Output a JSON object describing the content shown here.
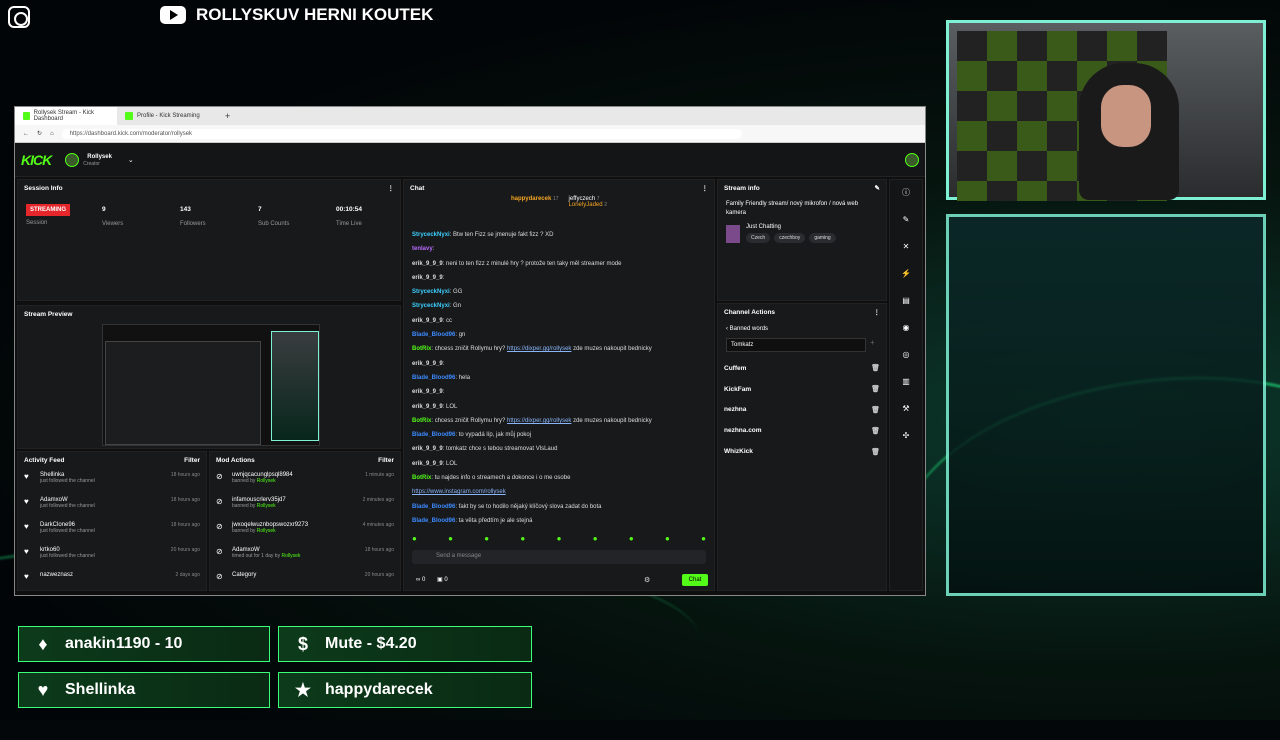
{
  "overlay": {
    "youtube_title": "ROLLYSKUV HERNI KOUTEK",
    "alerts": [
      {
        "icon": "diamond-icon",
        "glyph": "♦",
        "text": "anakin1190 - 10"
      },
      {
        "icon": "dollar-icon",
        "glyph": "$",
        "text": "Mute - $4.20"
      },
      {
        "icon": "heart-icon",
        "glyph": "♥",
        "text": "Shellinka"
      },
      {
        "icon": "star-icon",
        "glyph": "★",
        "text": "happydarecek"
      }
    ]
  },
  "browser": {
    "tabs": [
      "Rollysek Stream - Kick Dashboard",
      "Profile - Kick Streaming"
    ],
    "url": "https://dashboard.kick.com/moderator/rollysek"
  },
  "header": {
    "logo": "KICK",
    "user": "Rollysek",
    "role": "Creator"
  },
  "session": {
    "title": "Session Info",
    "status": "STREAMING",
    "status_label": "Session",
    "viewers": "9",
    "viewers_label": "Viewers",
    "followers": "143",
    "followers_label": "Followers",
    "subs": "7",
    "subs_label": "Sub Counts",
    "time": "00:10:54",
    "time_label": "Time Live"
  },
  "preview": {
    "title": "Stream Preview"
  },
  "activity": {
    "title": "Activity Feed",
    "filter": "Filter",
    "items": [
      {
        "name": "Shellinka",
        "sub": "just followed the channel",
        "time": "18 hours ago"
      },
      {
        "name": "AdamxoW",
        "sub": "just followed the channel",
        "time": "18 hours ago"
      },
      {
        "name": "DarkClone96",
        "sub": "just followed the channel",
        "time": "18 hours ago"
      },
      {
        "name": "krtko60",
        "sub": "just followed the channel",
        "time": "20 hours ago"
      },
      {
        "name": "nazweznasz",
        "sub": "",
        "time": "2 days ago"
      }
    ]
  },
  "mod": {
    "title": "Mod Actions",
    "filter": "Filter",
    "items": [
      {
        "name": "uwnjqcacunglpsql8984",
        "sub": "banned by",
        "by": "Rollysek",
        "time": "1 minute ago"
      },
      {
        "name": "infamouscrlerv35jd7",
        "sub": "banned by",
        "by": "Rollysek",
        "time": "2 minutes ago"
      },
      {
        "name": "jwxoqelwuznbopswozxr9273",
        "sub": "banned by",
        "by": "Rollysek",
        "time": "4 minutes ago"
      },
      {
        "name": "AdamxoW",
        "sub": "timed out for 1 day by",
        "by": "Rollysek",
        "time": "18 hours ago"
      },
      {
        "name": "Category",
        "sub": "",
        "by": "",
        "time": "20 hours ago"
      }
    ]
  },
  "chat": {
    "title": "Chat",
    "leaders": [
      {
        "name": "happydarecek",
        "count": "17"
      },
      {
        "name": "jeffyczech",
        "count": "7"
      },
      {
        "name": "LonelyJaded",
        "count": "2"
      }
    ],
    "messages": [
      {
        "user": "StryceckNyxi",
        "color": "#3dd0ff",
        "text": "Btw ten Fizz se jmenuje fakt fizz ? XD"
      },
      {
        "user": "tenlavy",
        "color": "#b96bff",
        "text": ""
      },
      {
        "user": "erik_9_9_9",
        "color": "#dddddd",
        "text": "neni to ten fizz z minulé hry ? protože ten taky měl streamer mode"
      },
      {
        "user": "erik_9_9_9",
        "color": "#dddddd",
        "text": ""
      },
      {
        "user": "StryceckNyxi",
        "color": "#3dd0ff",
        "text": "GG"
      },
      {
        "user": "StryceckNyxi",
        "color": "#3dd0ff",
        "text": "Gn"
      },
      {
        "user": "erik_9_9_9",
        "color": "#dddddd",
        "text": "cc"
      },
      {
        "user": "Blade_Blood96",
        "color": "#3d8bff",
        "text": "gn"
      },
      {
        "user": "BotRix",
        "color": "#53fc18",
        "text": "chcess zničit Rollymu hry? ",
        "link": "https://dixper.gg/rollysek",
        "after": " zde muzes nakoupit bednicky"
      },
      {
        "user": "erik_9_9_9",
        "color": "#dddddd",
        "text": ""
      },
      {
        "user": "Blade_Blood96",
        "color": "#3d8bff",
        "text": "hela"
      },
      {
        "user": "erik_9_9_9",
        "color": "#dddddd",
        "text": ""
      },
      {
        "user": "erik_9_9_9",
        "color": "#dddddd",
        "text": "LOL"
      },
      {
        "user": "BotRix",
        "color": "#53fc18",
        "text": "chcess zničit Rollymu hry? ",
        "link": "https://dixper.gg/rollysek",
        "after": " zde muzes nakoupit bednicky"
      },
      {
        "user": "Blade_Blood96",
        "color": "#3d8bff",
        "text": "to vypadá líp, jak můj pokoj"
      },
      {
        "user": "erik_9_9_9",
        "color": "#dddddd",
        "text": "tomkatz chce s tebou streamovat VlsLaud"
      },
      {
        "user": "erik_9_9_9",
        "color": "#dddddd",
        "text": "LOL"
      },
      {
        "user": "BotRix",
        "color": "#53fc18",
        "text": "tu najdes info o streamech a dokonce i o me osobe"
      },
      {
        "user": "",
        "color": "#8ab4f8",
        "text": "",
        "link": "https://www.instagram.com/rollysek"
      },
      {
        "user": "Blade_Blood96",
        "color": "#3d8bff",
        "text": "fakt by se to hodilo nějaký klíčový slova zadat do bota"
      },
      {
        "user": "Blade_Blood96",
        "color": "#3d8bff",
        "text": "ta věta předtím je ale stejná"
      }
    ],
    "placeholder": "Send a message",
    "send": "Chat",
    "count_a": "0",
    "count_b": "0"
  },
  "stream_info": {
    "title": "Stream info",
    "stream_title": "Family Friendly stream/ nový mikrofon / nová web kamera",
    "category": "Just Chatting",
    "tags": [
      "Czech",
      "czechboy",
      "gaming"
    ]
  },
  "channel_actions": {
    "title": "Channel Actions",
    "sub": "Banned words",
    "input_value": "Tomkatz",
    "words": [
      "Cuffem",
      "KickFam",
      "nezhna",
      "nezhna.com",
      "WhizKick"
    ]
  }
}
